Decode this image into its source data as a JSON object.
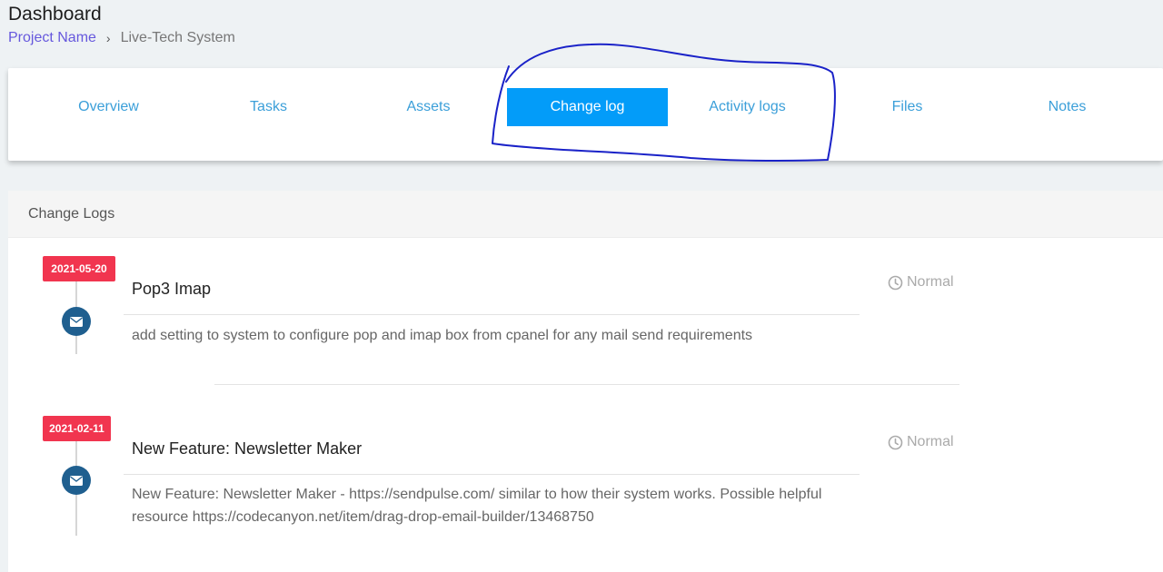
{
  "page": {
    "title": "Dashboard",
    "breadcrumb": {
      "project_link": "Project Name",
      "separator": "›",
      "current": "Live-Tech System"
    }
  },
  "tabs": [
    {
      "label": "Overview",
      "active": false
    },
    {
      "label": "Tasks",
      "active": false
    },
    {
      "label": "Assets",
      "active": false
    },
    {
      "label": "Change log",
      "active": true
    },
    {
      "label": "Activity logs",
      "active": false
    },
    {
      "label": "Files",
      "active": false
    },
    {
      "label": "Notes",
      "active": false
    }
  ],
  "change_logs": {
    "header": "Change Logs",
    "entries": [
      {
        "date": "2021-05-20",
        "title": "Pop3 Imap",
        "description": "add setting to system to configure pop and imap box from cpanel for any mail send requirements",
        "priority": "Normal",
        "icon": "mail-icon"
      },
      {
        "date": "2021-02-11",
        "title": "New Feature: Newsletter Maker",
        "description": "New Feature: Newsletter Maker - https://sendpulse.com/ similar to how their system works. Possible helpful resource https://codecanyon.net/item/drag-drop-email-builder/13468750",
        "priority": "Normal",
        "icon": "mail-icon"
      }
    ]
  },
  "colors": {
    "accent": "#039cf9",
    "tab_text": "#3b9fd9",
    "badge": "#f1354f",
    "mail_dot": "#1f5f8f",
    "breadcrumb_link": "#6658dd",
    "annotation_ink": "#1a22c8"
  }
}
